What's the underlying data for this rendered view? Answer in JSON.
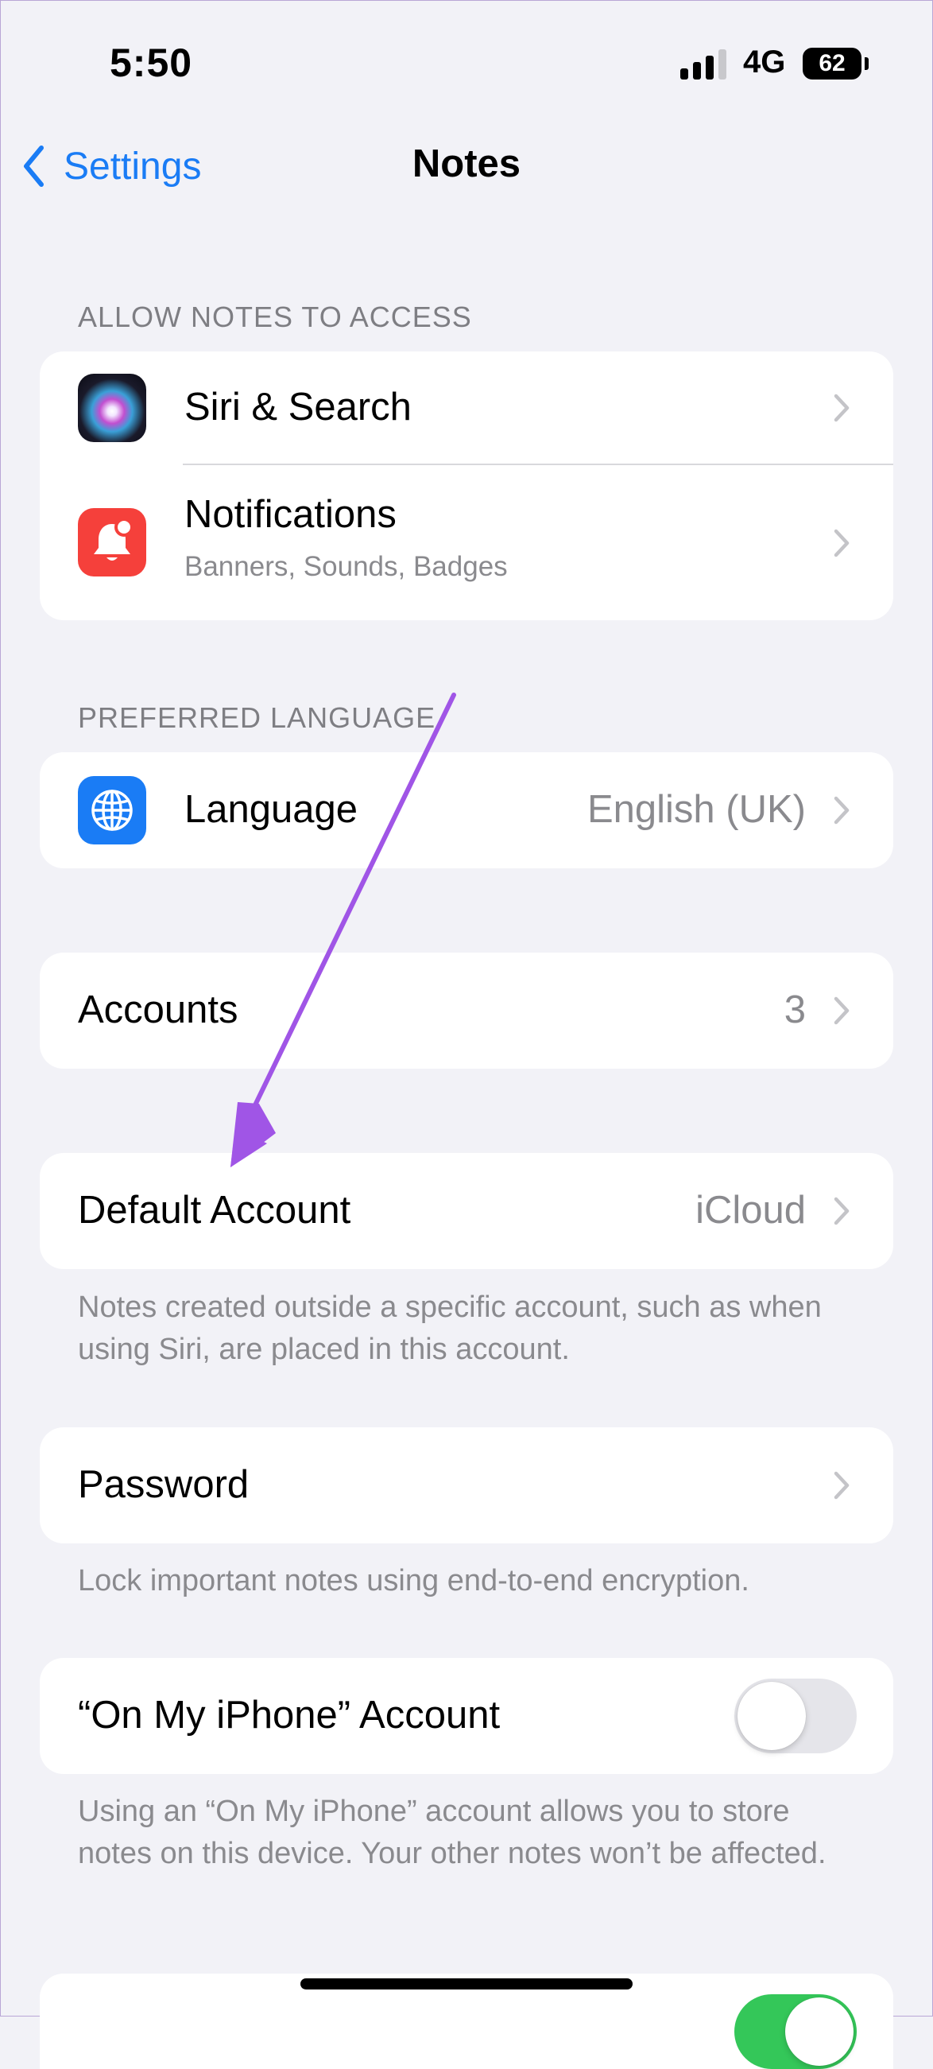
{
  "status_bar": {
    "time": "5:50",
    "network": "4G",
    "battery": "62"
  },
  "nav": {
    "back_label": "Settings",
    "title": "Notes"
  },
  "section_access": {
    "header": "ALLOW NOTES TO ACCESS",
    "siri": {
      "label": "Siri & Search",
      "icon": "siri-icon"
    },
    "notifications": {
      "label": "Notifications",
      "subtitle": "Banners, Sounds, Badges",
      "icon": "bell-badge-icon"
    }
  },
  "section_language": {
    "header": "PREFERRED LANGUAGE",
    "language": {
      "label": "Language",
      "value": "English (UK)",
      "icon": "globe-icon"
    }
  },
  "accounts": {
    "label": "Accounts",
    "value": "3"
  },
  "default_account": {
    "label": "Default Account",
    "value": "iCloud",
    "footnote": "Notes created outside a specific account, such as when using Siri, are placed in this account."
  },
  "password": {
    "label": "Password",
    "footnote": "Lock important notes using end-to-end encryption."
  },
  "on_my_iphone": {
    "label": "“On My iPhone” Account",
    "enabled": false,
    "footnote": "Using an “On My iPhone” account allows you to store notes on this device. Your other notes won’t be affected."
  },
  "next_toggle": {
    "enabled": true
  },
  "colors": {
    "accent": "#1A7CF5",
    "toggle_on": "#34C759",
    "annotation_arrow": "#A055E6",
    "notification_icon": "#F5403B",
    "language_icon": "#1A7CF5"
  }
}
